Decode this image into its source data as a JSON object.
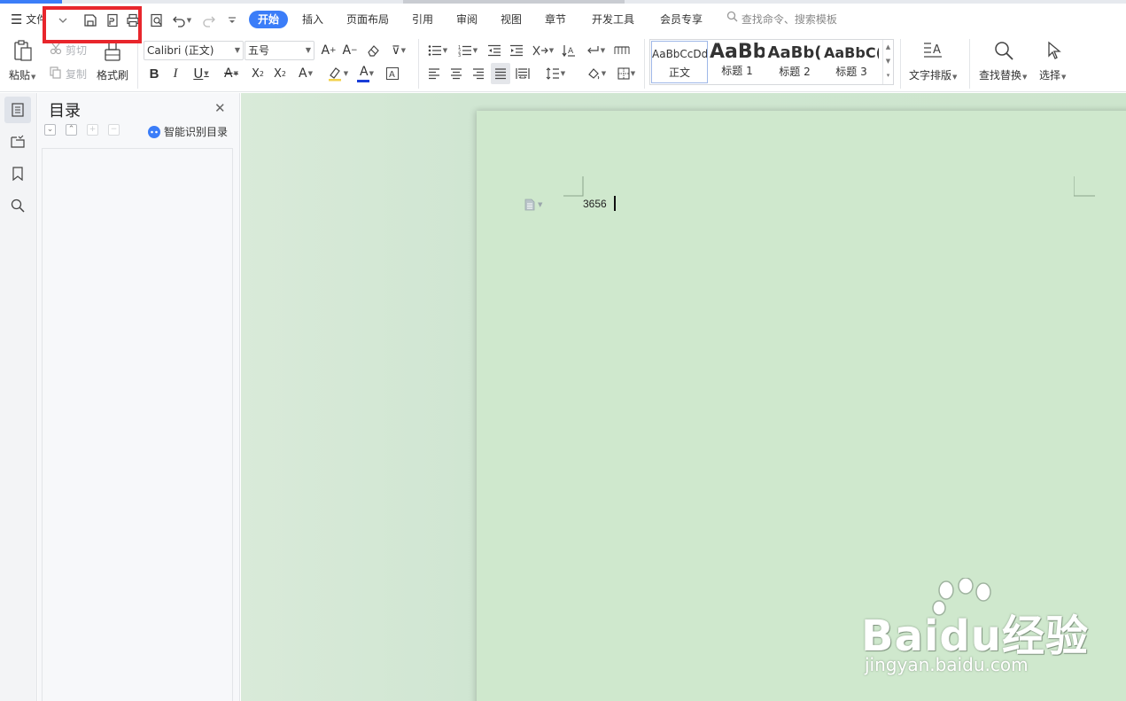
{
  "menu": {
    "file_label": "文件",
    "tabs": [
      "开始",
      "插入",
      "页面布局",
      "引用",
      "审阅",
      "视图",
      "章节",
      "开发工具",
      "会员专享"
    ],
    "active_tab": "开始",
    "search_placeholder": "查找命令、搜索模板"
  },
  "ribbon": {
    "paste": "粘贴",
    "cut": "剪切",
    "copy": "复制",
    "format_painter": "格式刷",
    "font_name": "Calibri (正文)",
    "font_size": "五号",
    "styles": [
      {
        "sample": "AaBbCcDd",
        "caption": "正文"
      },
      {
        "sample": "AaBb",
        "caption": "标题 1"
      },
      {
        "sample": "AaBb(",
        "caption": "标题 2"
      },
      {
        "sample": "AaBbC(",
        "caption": "标题 3"
      }
    ],
    "text_layout": "文字排版",
    "find_replace": "查找替换",
    "select": "选择"
  },
  "toc": {
    "title": "目录",
    "smart_button": "智能识别目录"
  },
  "document": {
    "text": "3656"
  },
  "watermark": {
    "brand": "Baidu经验",
    "url": "jingyan.baidu.com"
  },
  "colors": {
    "accent": "#3b7df8",
    "highlight_box": "#e8262c",
    "page_background": "#cfe8cd"
  }
}
